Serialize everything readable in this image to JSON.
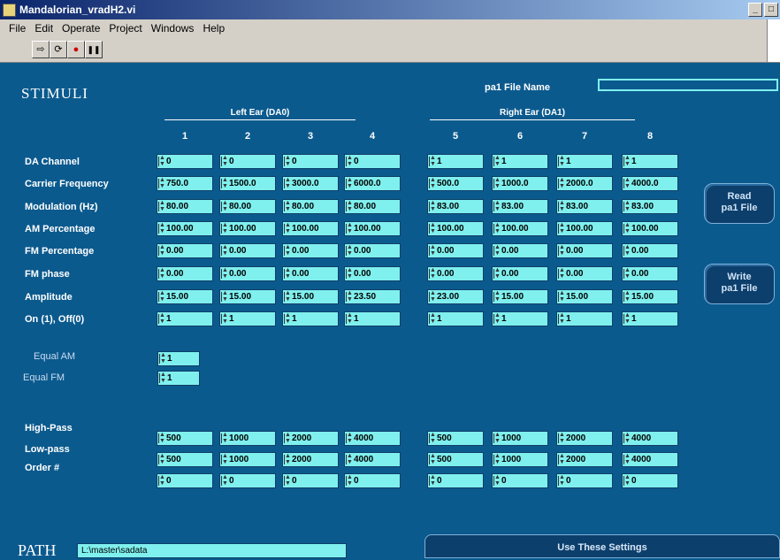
{
  "window": {
    "title": "Mandalorian_vradH2.vi"
  },
  "menu": {
    "items": [
      "File",
      "Edit",
      "Operate",
      "Project",
      "Windows",
      "Help"
    ]
  },
  "toolbar": {
    "run": "⇨",
    "run_cont": "⟳",
    "abort": "●",
    "pause": "❚❚"
  },
  "panel": {
    "title": "STIMULI",
    "file_name_label": "pa1 File Name",
    "file_name_value": "",
    "left_group": "Left Ear (DA0)",
    "right_group": "Right Ear (DA1)",
    "columns": [
      "1",
      "2",
      "3",
      "4",
      "5",
      "6",
      "7",
      "8"
    ],
    "row_labels": [
      "DA Channel",
      "Carrier Frequency",
      "Modulation (Hz)",
      "AM Percentage",
      "FM Percentage",
      "FM phase",
      "Amplitude",
      "On (1), Off(0)"
    ],
    "grid": [
      [
        "0",
        "0",
        "0",
        "0",
        "1",
        "1",
        "1",
        "1"
      ],
      [
        "750.0",
        "1500.0",
        "3000.0",
        "6000.0",
        "500.0",
        "1000.0",
        "2000.0",
        "4000.0"
      ],
      [
        "80.00",
        "80.00",
        "80.00",
        "80.00",
        "83.00",
        "83.00",
        "83.00",
        "83.00"
      ],
      [
        "100.00",
        "100.00",
        "100.00",
        "100.00",
        "100.00",
        "100.00",
        "100.00",
        "100.00"
      ],
      [
        "0.00",
        "0.00",
        "0.00",
        "0.00",
        "0.00",
        "0.00",
        "0.00",
        "0.00"
      ],
      [
        "0.00",
        "0.00",
        "0.00",
        "0.00",
        "0.00",
        "0.00",
        "0.00",
        "0.00"
      ],
      [
        "15.00",
        "15.00",
        "15.00",
        "23.50",
        "23.00",
        "15.00",
        "15.00",
        "15.00"
      ],
      [
        "1",
        "1",
        "1",
        "1",
        "1",
        "1",
        "1",
        "1"
      ]
    ],
    "equal_am_label": "Equal AM",
    "equal_fm_label": "Equal FM",
    "equal_am_value": "1",
    "equal_fm_value": "1",
    "filter_labels": [
      "High-Pass",
      "Low-pass",
      "Order #"
    ],
    "filters": [
      [
        "500",
        "1000",
        "2000",
        "4000",
        "500",
        "1000",
        "2000",
        "4000"
      ],
      [
        "500",
        "1000",
        "2000",
        "4000",
        "500",
        "1000",
        "2000",
        "4000"
      ],
      [
        "0",
        "0",
        "0",
        "0",
        "0",
        "0",
        "0",
        "0"
      ]
    ],
    "read_button": "Read\npa1 File",
    "write_button": "Write\npa1 File",
    "use_button": "Use These Settings",
    "path_label": "PATH",
    "path_value": "L:\\master\\sadata"
  }
}
